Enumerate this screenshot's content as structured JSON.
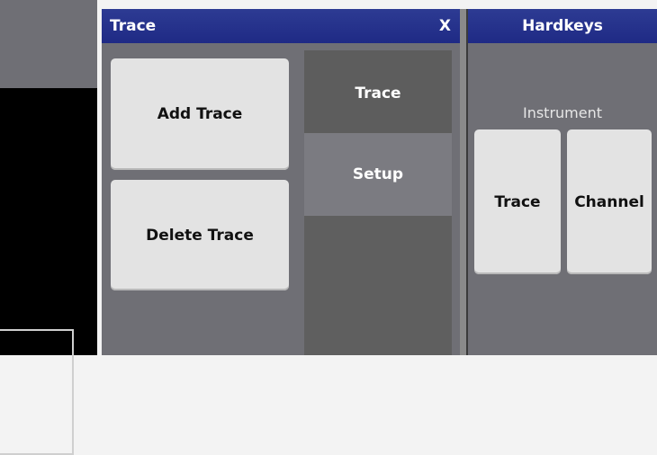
{
  "trace_panel": {
    "title": "Trace",
    "close_label": "X",
    "buttons": {
      "add": "Add Trace",
      "delete": "Delete Trace"
    },
    "tabs": {
      "trace": "Trace",
      "setup": "Setup"
    }
  },
  "hardkeys_panel": {
    "title": "Hardkeys",
    "section_label": "Instrument",
    "buttons": {
      "trace": "Trace",
      "channel": "Channel"
    }
  },
  "colors": {
    "titlebar": "#2d3b93",
    "panel_bg": "#6f6f75",
    "button_bg": "#e3e3e3",
    "tab_dark": "#5d5d5d",
    "tab_light": "#7b7b81"
  }
}
